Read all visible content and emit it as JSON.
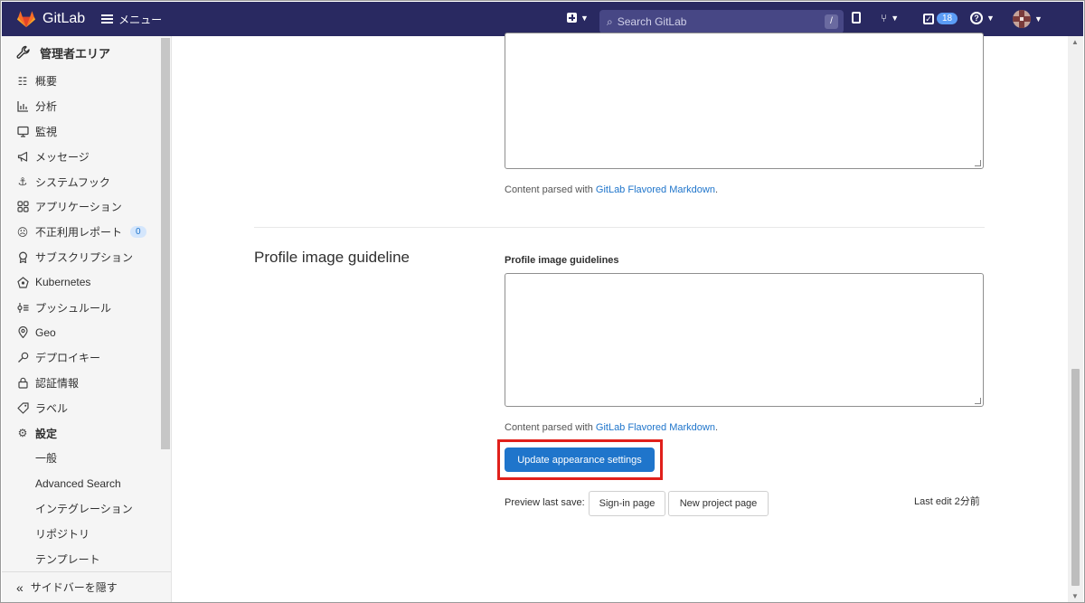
{
  "navbar": {
    "brand": "GitLab",
    "menu_label": "メニュー",
    "search_placeholder": "Search GitLab",
    "search_shortcut": "/",
    "todo_count": "18"
  },
  "sidebar": {
    "title": "管理者エリア",
    "items": [
      {
        "label": "概要",
        "icon": "overview-icon"
      },
      {
        "label": "分析",
        "icon": "analytics-icon"
      },
      {
        "label": "監視",
        "icon": "monitor-icon"
      },
      {
        "label": "メッセージ",
        "icon": "megaphone-icon"
      },
      {
        "label": "システムフック",
        "icon": "anchor-icon"
      },
      {
        "label": "アプリケーション",
        "icon": "applications-icon"
      },
      {
        "label": "不正利用レポート",
        "icon": "abuse-report-icon",
        "count": "0"
      },
      {
        "label": "サブスクリプション",
        "icon": "subscription-icon"
      },
      {
        "label": "Kubernetes",
        "icon": "kubernetes-icon"
      },
      {
        "label": "プッシュルール",
        "icon": "push-rules-icon"
      },
      {
        "label": "Geo",
        "icon": "geo-icon"
      },
      {
        "label": "デプロイキー",
        "icon": "deploy-key-icon"
      },
      {
        "label": "認証情報",
        "icon": "lock-icon"
      },
      {
        "label": "ラベル",
        "icon": "label-icon"
      },
      {
        "label": "設定",
        "icon": "settings-icon"
      }
    ],
    "sub_items": [
      {
        "label": "一般"
      },
      {
        "label": "Advanced Search"
      },
      {
        "label": "インテグレーション"
      },
      {
        "label": "リポジトリ"
      },
      {
        "label": "テンプレート"
      }
    ],
    "collapse_label": "サイドバーを隠す"
  },
  "main": {
    "help_prefix": "Content parsed with ",
    "help_link": "GitLab Flavored Markdown",
    "help_suffix": ".",
    "section_title": "Profile image guideline",
    "field_label": "Profile image guidelines",
    "field_value": "",
    "submit_label": "Update appearance settings",
    "preview_label": "Preview last save:",
    "signin_button": "Sign-in page",
    "new_project_button": "New project page",
    "last_edit": "Last edit 2分前"
  },
  "colors": {
    "navbar_bg": "#292961",
    "primary": "#1f75cb",
    "highlight": "#e0201b"
  }
}
